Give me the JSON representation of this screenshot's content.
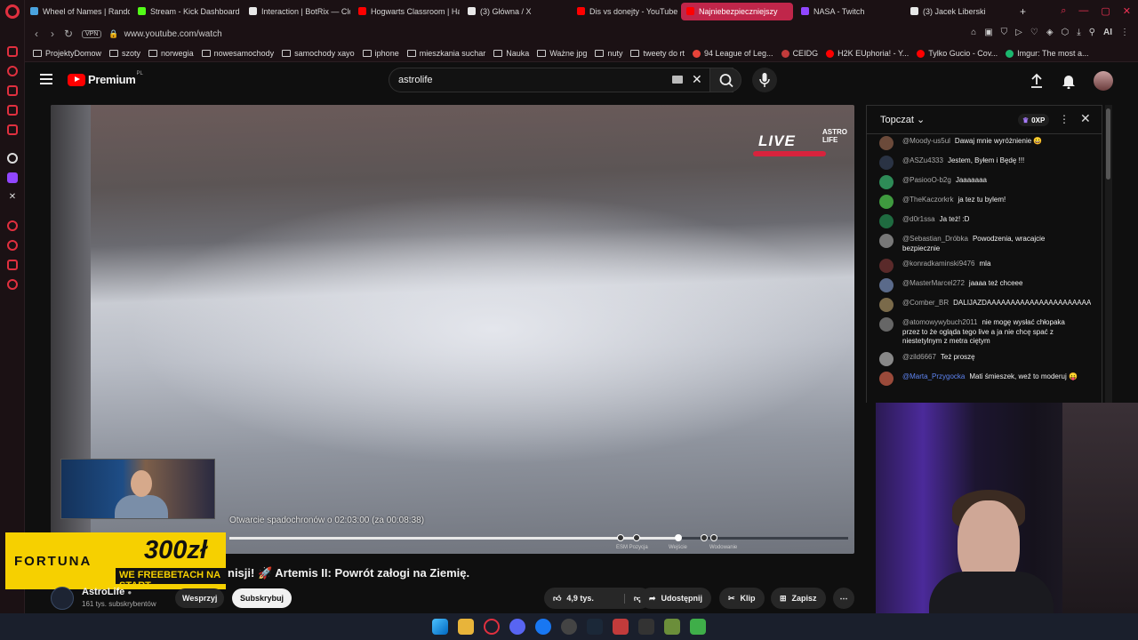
{
  "browser": {
    "tabs": [
      {
        "title": "Wheel of Names | Rando",
        "color": "#4aa3df"
      },
      {
        "title": "Stream - Kick Dashboard",
        "color": "#53fc18"
      },
      {
        "title": "Interaction | BotRix — Clo",
        "color": "#e8e8e8"
      },
      {
        "title": "Hogwarts Classroom | Ha",
        "color": "#ff0000"
      },
      {
        "title": "(3) Główna / X",
        "color": "#e8e8e8"
      },
      {
        "title": "Dis vs donejty - YouTube",
        "color": "#ff0000"
      },
      {
        "title": "Najniebezpieczniejszy",
        "color": "#ff0000"
      },
      {
        "title": "NASA - Twitch",
        "color": "#9146ff"
      },
      {
        "title": "(3) Jacek Liberski",
        "color": "#e8e8e8"
      }
    ],
    "vpn": "VPN",
    "url": "www.youtube.com/watch",
    "ai": "AI",
    "bookmarks": [
      {
        "label": "ProjektyDomow",
        "kind": "folder"
      },
      {
        "label": "szoty",
        "kind": "folder"
      },
      {
        "label": "norwegia",
        "kind": "folder"
      },
      {
        "label": "nowesamochody",
        "kind": "folder"
      },
      {
        "label": "samochody xayo",
        "kind": "folder"
      },
      {
        "label": "iphone",
        "kind": "folder"
      },
      {
        "label": "mieszkania suchar",
        "kind": "folder"
      },
      {
        "label": "Nauka",
        "kind": "folder"
      },
      {
        "label": "Ważne jpg",
        "kind": "folder"
      },
      {
        "label": "nuty",
        "kind": "folder"
      },
      {
        "label": "tweety do rt",
        "kind": "folder"
      },
      {
        "label": "94 League of Leg...",
        "kind": "site",
        "color": "#e8443a"
      },
      {
        "label": "CEIDG",
        "kind": "site",
        "color": "#c23b3b"
      },
      {
        "label": "H2K EUphoria! - Y...",
        "kind": "site",
        "color": "#ff0000"
      },
      {
        "label": "Tylko Gucio - Cov...",
        "kind": "site",
        "color": "#ff0000"
      },
      {
        "label": "Imgur: The most a...",
        "kind": "site",
        "color": "#1bb76e"
      }
    ]
  },
  "youtube": {
    "logo_text": "Premium",
    "logo_region": "PL",
    "search_value": "astrolife",
    "video": {
      "live_label": "LIVE",
      "brand_line1": "ASTRO",
      "brand_line2": "LIFE",
      "overlay": "Otwarcie spadochronów o 02:03:00 (za 00:08:38)",
      "progress": 0.726,
      "markers": [
        {
          "label": "ESM Pozycja"
        },
        {
          "label": "Wejście"
        },
        {
          "label": "Wodowanie"
        }
      ]
    },
    "ad": {
      "brand": "FORTUNA",
      "amount": "300zł",
      "promo": "WE FREEBETACH NA START"
    },
    "title": "nisji! 🚀 Artemis II: Powrót załogi na Ziemię.",
    "channel": {
      "name": "AstroLife",
      "subscribers": "161 tys. subskrybentów"
    },
    "buttons": {
      "support": "Wesprzyj",
      "subscribe": "Subskrybuj",
      "likes": "4,9 tys.",
      "share": "Udostępnij",
      "clip": "Klip",
      "save": "Zapisz"
    }
  },
  "chat": {
    "mode": "Topczat",
    "xp": "0XP",
    "messages": [
      {
        "author": "@Moody-us5ul",
        "text": "Dawaj mnie wyróżnienie 😀",
        "avatar": "#6b4a3a"
      },
      {
        "author": "@ASZu4333",
        "text": "Jestem, Byłem i Będę !!!",
        "avatar": "#2a3344"
      },
      {
        "author": "@PasiooO-b2g",
        "text": "Jaaaaaaa",
        "avatar": "#2e8b57"
      },
      {
        "author": "@TheKaczorkrk",
        "text": "ja tez tu bylem!",
        "avatar": "#3f9a3f"
      },
      {
        "author": "@d0r1ssa",
        "text": "Ja też! :D",
        "avatar": "#1f6b40"
      },
      {
        "author": "@Sebastian_Dróbka",
        "text": "Powodzenia, wracajcie bezpiecznie",
        "avatar": "#777"
      },
      {
        "author": "@konradkaminski9476",
        "text": "mla",
        "avatar": "#5a2a2a"
      },
      {
        "author": "@MasterMarcel272",
        "text": "jaaaa też chceee",
        "avatar": "#5a6a8a"
      },
      {
        "author": "@Comber_BR",
        "text": "DALIJAZDAAAAAAAAAAAAAAAAAAAAAAAAAAAAAAAAAAAAAAAAAAAAA",
        "avatar": "#7a6a4a"
      },
      {
        "author": "@atomowywybuch2011",
        "text": "nie mogę wysłać chłopaka przez to że ogląda tego live a ja nie chcę spać z niestetylnym z metra ciętym",
        "avatar": "#666"
      },
      {
        "author": "@zild6667",
        "text": "Też proszę",
        "avatar": "#888"
      },
      {
        "author": "@Marta_Przygocka",
        "text": "Mati śmieszek, weź to moderuj 😛",
        "avatar": "#9a4a3a",
        "mod": true
      }
    ]
  }
}
